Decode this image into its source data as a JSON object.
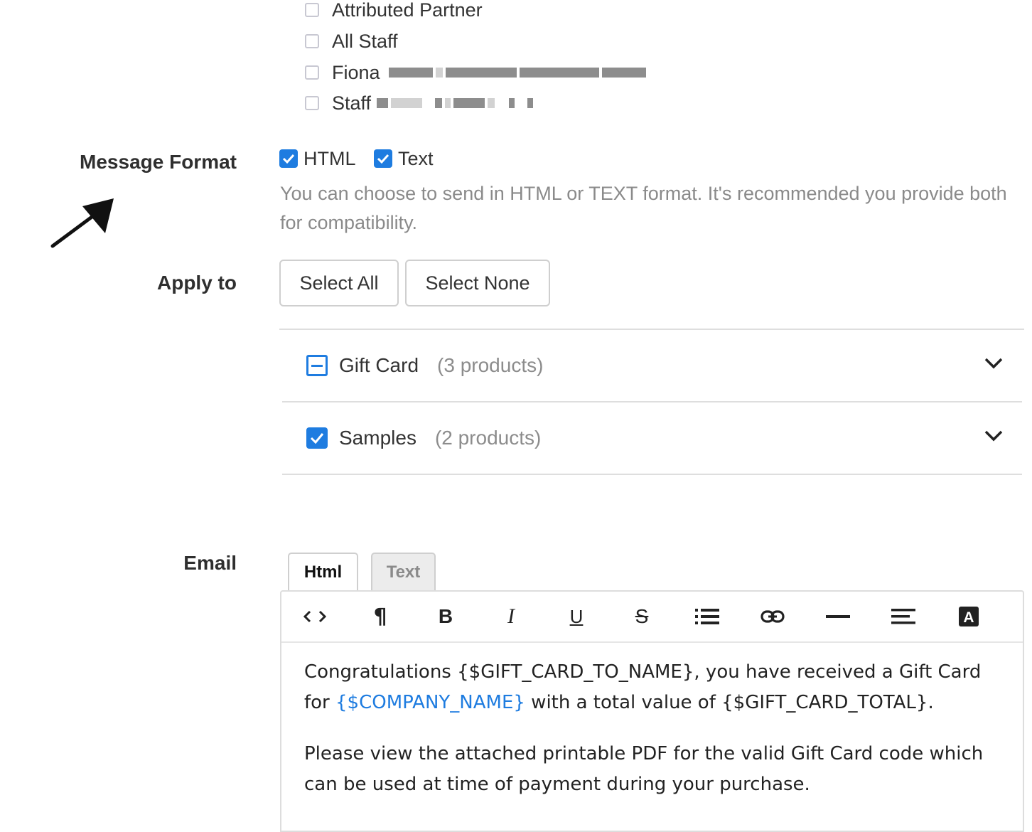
{
  "recipients": [
    {
      "label": "Attributed Partner",
      "checked": false
    },
    {
      "label": "All Staff",
      "checked": false
    },
    {
      "label": "Fiona",
      "checked": false
    },
    {
      "label": "Staff",
      "checked": false
    }
  ],
  "message_format": {
    "label": "Message Format",
    "options": [
      {
        "label": "HTML",
        "checked": true
      },
      {
        "label": "Text",
        "checked": true
      }
    ],
    "help": "You can choose to send in HTML or TEXT format. It's recommended you provide both for compatibility."
  },
  "apply_to": {
    "label": "Apply to",
    "select_all": "Select All",
    "select_none": "Select None",
    "groups": [
      {
        "name": "Gift Card",
        "count": "(3 products)",
        "state": "partial"
      },
      {
        "name": "Samples",
        "count": "(2 products)",
        "state": "checked"
      }
    ]
  },
  "email": {
    "label": "Email",
    "tabs": [
      {
        "label": "Html",
        "active": true
      },
      {
        "label": "Text",
        "active": false
      }
    ],
    "toolbar": [
      "code-view-icon",
      "paragraph-icon",
      "bold-icon",
      "italic-icon",
      "underline-icon",
      "strikethrough-icon",
      "list-icon",
      "link-icon",
      "horizontal-rule-icon",
      "align-icon",
      "text-color-icon"
    ],
    "body": {
      "p1_a": "Congratulations {$GIFT_CARD_TO_NAME}, you have received a Gift Card for ",
      "p1_link": "{$COMPANY_NAME}",
      "p1_b": " with a total value of {$GIFT_CARD_TOTAL}.",
      "p2": "Please view the attached printable PDF for the valid Gift Card code which can be used at time of payment during your purchase."
    }
  },
  "colors": {
    "accent": "#1e7ce0",
    "muted_text": "#8a8a8a",
    "border": "#cfcfcf"
  }
}
